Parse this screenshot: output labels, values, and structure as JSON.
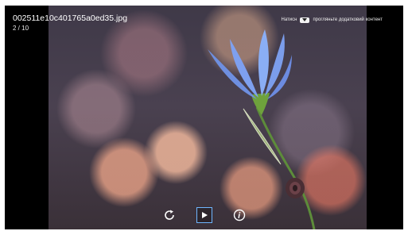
{
  "viewer": {
    "file_name": "002511e10c401765a0ed35.jpg",
    "position": "2 / 10"
  },
  "hint": {
    "text_before": "Натисн",
    "text_after": "прогляньте додатковий контент"
  },
  "controls": {
    "rotate_icon": "rotate-icon",
    "play_icon": "play-icon",
    "info_icon": "info-icon"
  },
  "colors": {
    "focus_border": "#6fb6ff"
  }
}
